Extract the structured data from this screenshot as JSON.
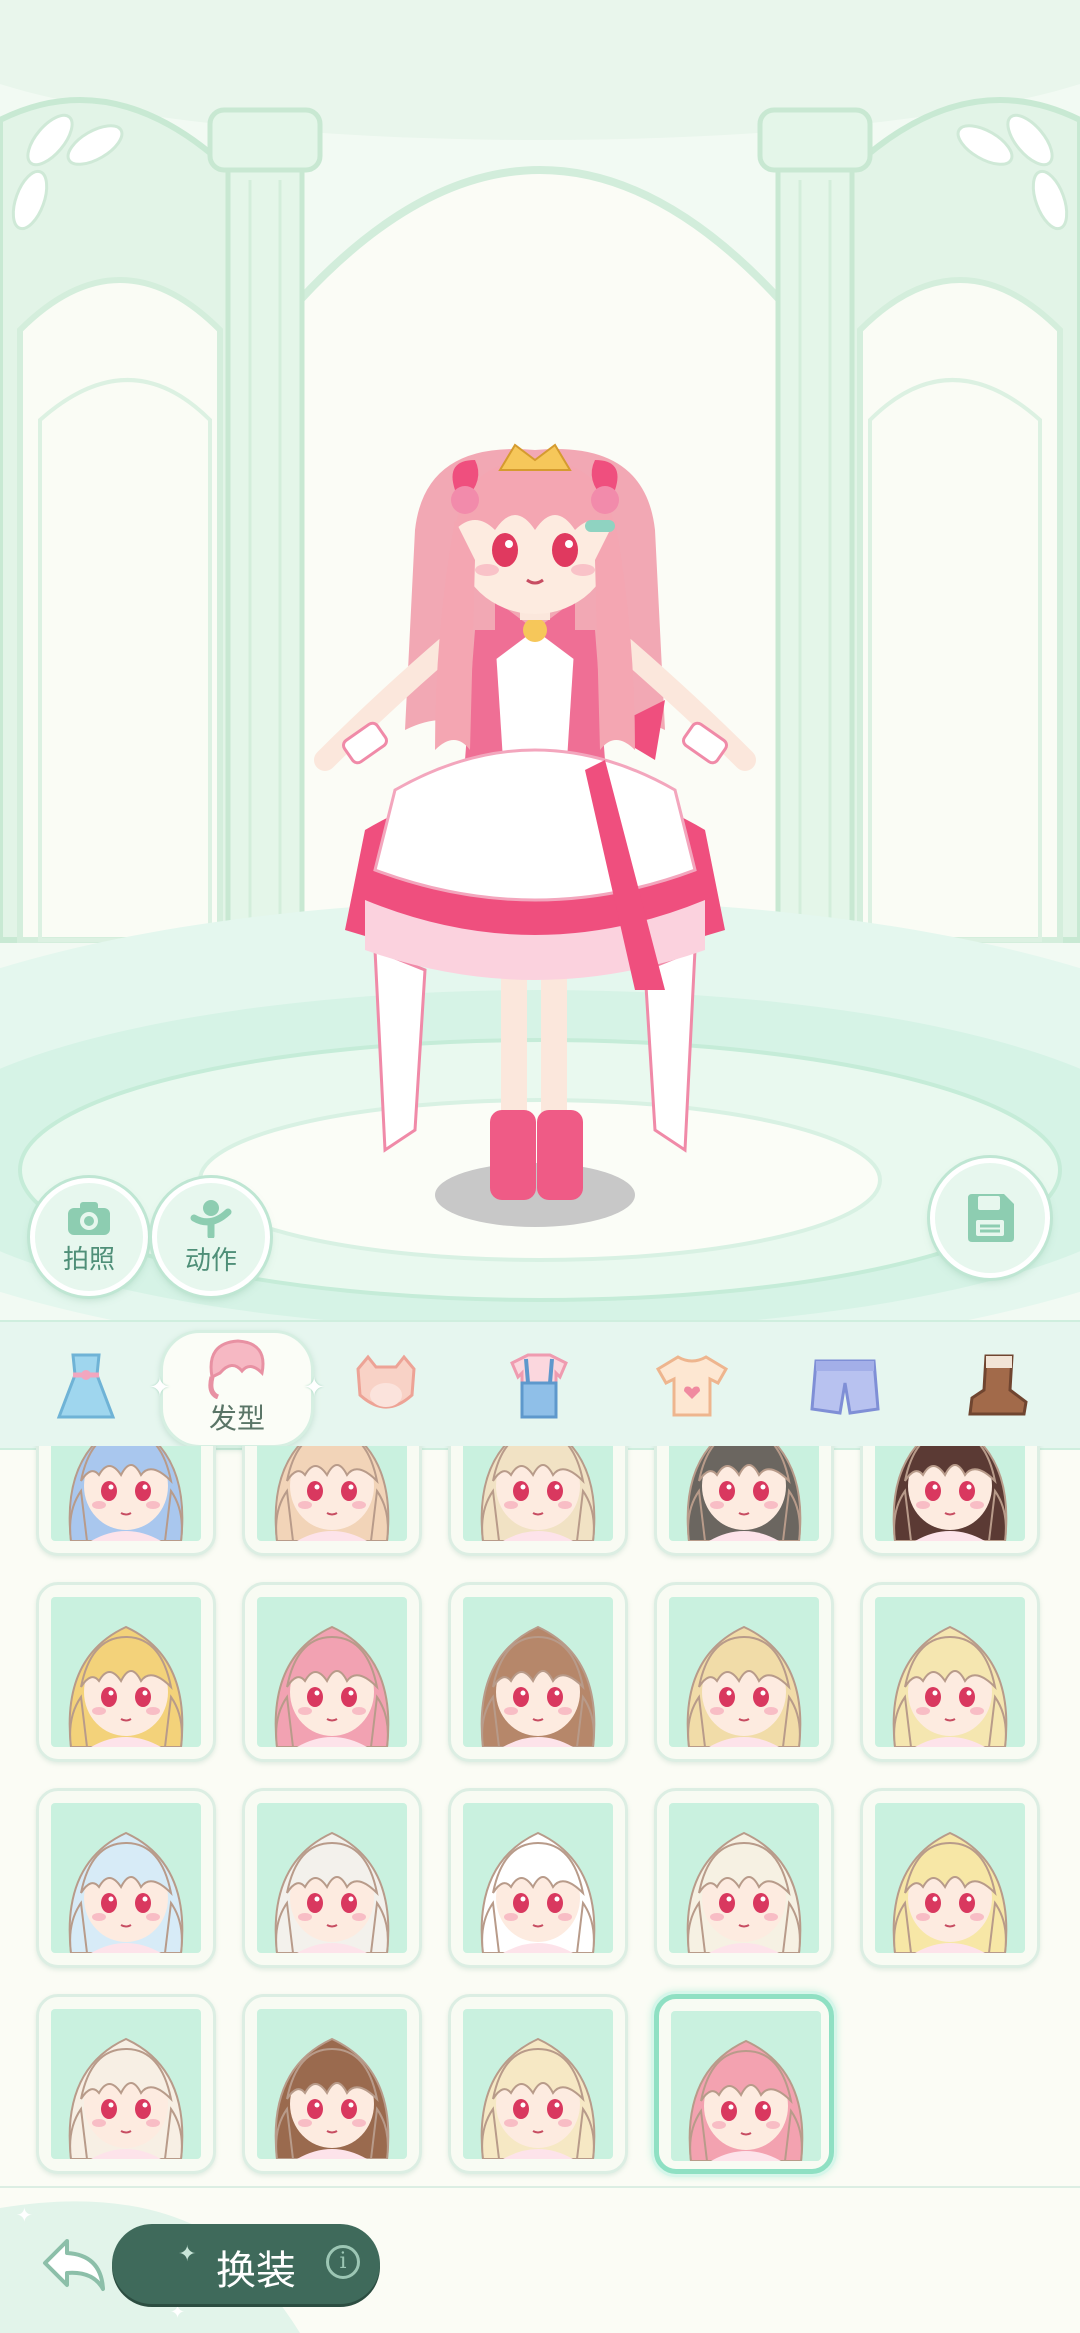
{
  "stage": {
    "camera_label": "拍照",
    "camera_icon": "camera-icon",
    "action_label": "动作",
    "action_icon": "pose-icon",
    "save_icon": "save-icon"
  },
  "tabs": {
    "items": [
      {
        "name": "dress",
        "icon": "dress-icon"
      },
      {
        "name": "hairstyle",
        "icon": "hair-icon",
        "label": "发型"
      },
      {
        "name": "face",
        "icon": "face-icon"
      },
      {
        "name": "overalls",
        "icon": "overalls-icon"
      },
      {
        "name": "top",
        "icon": "tshirt-icon"
      },
      {
        "name": "shorts",
        "icon": "shorts-icon"
      },
      {
        "name": "shoes",
        "icon": "boot-icon"
      }
    ],
    "selected": "hairstyle"
  },
  "hair_grid": {
    "rows": [
      [
        "#a9c7ee",
        "#f2d4b8",
        "#f1e2c4",
        "#6b6660",
        "#5b3a34"
      ],
      [
        "#f3d27a",
        "#f2a2b2",
        "#b6876a",
        "#f1dca8",
        "#f5e6b0"
      ],
      [
        "#d7ebf7",
        "#f3f1ec",
        "#ffffff",
        "#f6f1e3",
        "#f7e7a6"
      ],
      [
        "#f7efe4",
        "#9a6a4e",
        "#f6e8c4",
        "#f3a2b0"
      ]
    ],
    "selected_row": 3,
    "selected_col": 3
  },
  "bottom": {
    "back_icon": "back-arrow-icon",
    "dress_up_label": "换装",
    "info_label": "i"
  },
  "colors": {
    "accent": "#3f6a5b",
    "mint": "#c9f1df",
    "pink": "#ef4f7e"
  }
}
